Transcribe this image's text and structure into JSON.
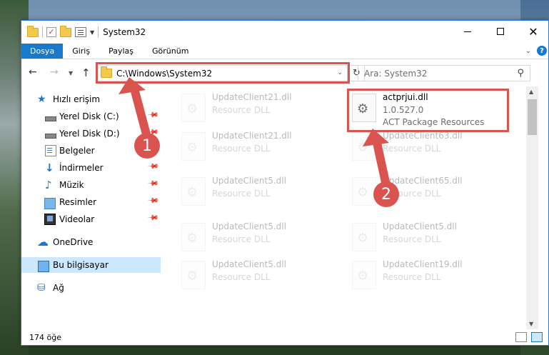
{
  "window": {
    "title": "System32"
  },
  "ribbon": {
    "tabs": [
      "Dosya",
      "Giriş",
      "Paylaş",
      "Görünüm"
    ]
  },
  "address": {
    "path": "C:\\Windows\\System32",
    "search_placeholder": "Ara: System32"
  },
  "nav": {
    "items": [
      {
        "label": "Hızlı erişim",
        "icon": "star-icon"
      },
      {
        "label": "Yerel Disk (C:)",
        "icon": "drive-icon",
        "pinned": true
      },
      {
        "label": "Yerel Disk (D:)",
        "icon": "drive-icon",
        "pinned": true
      },
      {
        "label": "Belgeler",
        "icon": "document-icon",
        "pinned": true
      },
      {
        "label": "İndirmeler",
        "icon": "download-icon",
        "pinned": true
      },
      {
        "label": "Müzik",
        "icon": "music-icon",
        "pinned": true
      },
      {
        "label": "Resimler",
        "icon": "picture-icon",
        "pinned": true
      },
      {
        "label": "Videolar",
        "icon": "video-icon",
        "pinned": true
      },
      {
        "label": "OneDrive",
        "icon": "cloud-icon"
      },
      {
        "label": "Bu bilgisayar",
        "icon": "computer-icon",
        "selected": true
      },
      {
        "label": "Ağ",
        "icon": "network-icon"
      }
    ]
  },
  "files": {
    "highlighted": {
      "name": "actprjui.dll",
      "version": "1.0.527.0",
      "description": "ACT Package Resources"
    },
    "left_column": [
      {
        "name": "UpdateClient21.dll",
        "desc": "Resource DLL"
      },
      {
        "name": "UpdateClient21.dll",
        "desc": "Resource DLL"
      },
      {
        "name": "UpdateClient5.dll",
        "desc": "Resource DLL"
      },
      {
        "name": "UpdateClient5.dll",
        "desc": "Resource DLL"
      },
      {
        "name": "UpdateClient5.dll",
        "desc": "Resource DLL"
      }
    ],
    "right_column": [
      {
        "name": "UpdateClient63.dll",
        "desc": "Resource DLL"
      },
      {
        "name": "UpdateClient65.dll",
        "desc": "Resource DLL"
      },
      {
        "name": "UpdateClient5.dll",
        "desc": "Resource DLL"
      },
      {
        "name": "UpdateClient19.dll",
        "desc": "Resource DLL"
      }
    ]
  },
  "annotations": {
    "badge1": "1",
    "badge2": "2",
    "color": "#d9534f"
  },
  "status": {
    "item_count": "174 öğe"
  }
}
